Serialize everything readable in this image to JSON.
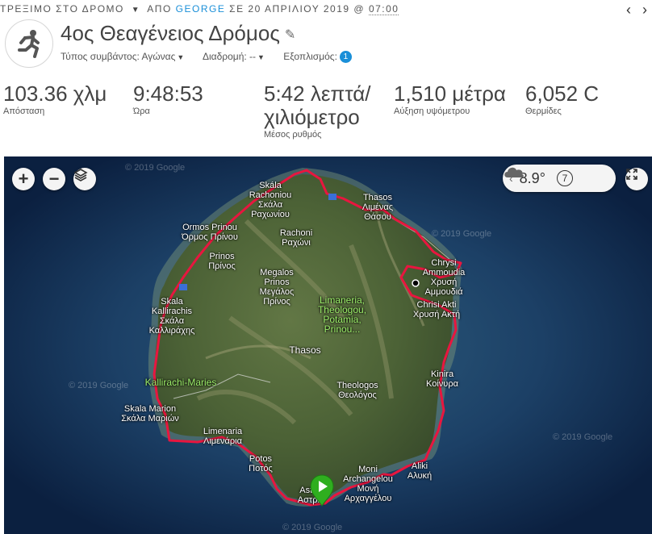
{
  "header": {
    "prefix": "ΤΡΕΞΙΜΟ ΣΤΟ ΔΡΟΜΟ",
    "from_label": "ΑΠΟ",
    "user": "GEORGE",
    "date_text": "ΣΕ 20 ΑΠΡΙΛΙΟΥ 2019 @",
    "time": "07:00",
    "prev_arrow": "‹",
    "next_arrow": "›"
  },
  "activity": {
    "title": "4ος Θεαγένειος Δρόμος",
    "icon": "running-person-icon",
    "event_type_label": "Τύπος συμβάντος: Αγώνας",
    "course_label": "Διαδρομή: --",
    "gear_label": "Εξοπλισμός:",
    "gear_count": "1"
  },
  "stats": [
    {
      "value": "103.36 χλμ",
      "label": "Απόσταση"
    },
    {
      "value": "9:48:53",
      "label": "Ώρα"
    },
    {
      "value": "5:42 λεπτά/\nχιλιόμετρο",
      "label": "Μέσος ρυθμός"
    },
    {
      "value": "1,510 μέτρα",
      "label": "Αύξηση υψόμετρου"
    },
    {
      "value": "6,052 C",
      "label": "Θερμίδες"
    }
  ],
  "map": {
    "zoom_in": "+",
    "zoom_out": "−",
    "layers_icon": "layers-icon",
    "weather_temp": "8.9°",
    "weather_icon": "cloud-icon",
    "wind_speed": "7",
    "expand_icon": "expand-icon",
    "watermark": "© 2019 Google",
    "route_color": "#e8163f",
    "start_color": "#2fae1f",
    "places": [
      {
        "text": "Skála\nRachoniou\nΣκάλα\nΡαχωνίου"
      },
      {
        "text": "Thasos\nΛιμένας\nΘάσου"
      },
      {
        "text": "Ormos Prinou\nΌρμος Πρίνου"
      },
      {
        "text": "Rachoni\nΡαχώνι"
      },
      {
        "text": "Prinos\nΠρίνος"
      },
      {
        "text": "Chrysi\nAmmoudia\nΧρυσή\nΑμμουδιά"
      },
      {
        "text": "Megalos\nPrinos\nΜεγάλος\nΠρίνος"
      },
      {
        "text": "Skala\nKallirachis\nΣκάλα\nΚαλλιράχης"
      },
      {
        "text": "Limaneria,\nTheologou,\nPotamia,\nPrinou..."
      },
      {
        "text": "Chrisi Akti\nΧρυσή Ακτή"
      },
      {
        "text": "Thasos"
      },
      {
        "text": "Kinira\nΚοίνυρα"
      },
      {
        "text": "Kallirachi-Maries"
      },
      {
        "text": "Theologos\nΘεολόγος"
      },
      {
        "text": "Skala Marion\nΣκάλα Μαριών"
      },
      {
        "text": "Limenaria\nΛιμενάρια"
      },
      {
        "text": "Potos\nΠοτός"
      },
      {
        "text": "Aliki\nΑλυκή"
      },
      {
        "text": "Moni\nArchangelou\nΜονή\nΑρχαγγέλου"
      },
      {
        "text": "Astris\nΑστρίς"
      }
    ]
  }
}
